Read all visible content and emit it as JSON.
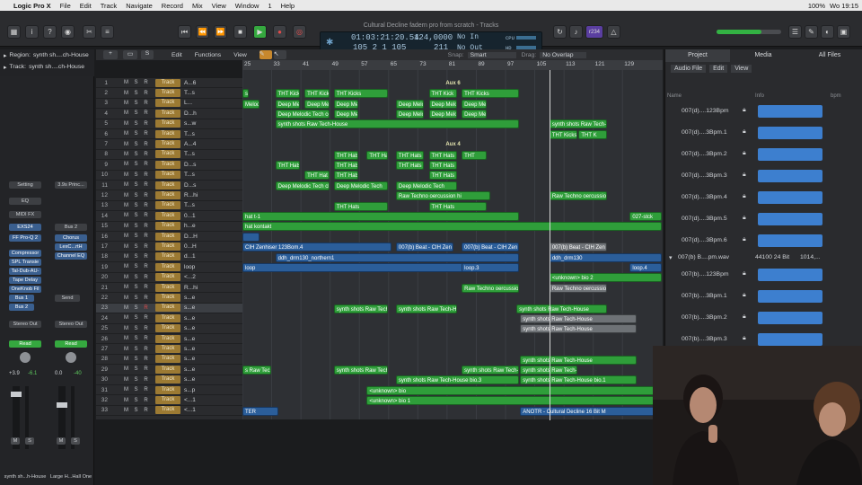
{
  "menubar": {
    "apple": "",
    "app": "Logic Pro X",
    "items": [
      "File",
      "Edit",
      "Track",
      "Navigate",
      "Record",
      "Mix",
      "View",
      "Window",
      "1",
      "Help"
    ],
    "status": [
      "100%",
      "Wo 19:15"
    ]
  },
  "window_title": "Cultural Decline fadern pro from scratch - Tracks",
  "lcd": {
    "position_time": "01:03:21:20.54",
    "position_bars": "105  2  1  105",
    "tempo": "124,0000",
    "tempo_sub": "211",
    "midi_in": "No In",
    "midi_out": "No Out",
    "cpu_label": "CPU",
    "hd_label": "HD"
  },
  "toolbar_badge": "r234",
  "inspector": {
    "region_label": "Region:",
    "region_value": "synth sh....ch-House",
    "track_label": "Track:",
    "track_value": "synth sh....ch-House",
    "strip1": {
      "setting": "Setting",
      "eq": "EQ",
      "midi_fx": "MIDI FX",
      "inst": "EXS24",
      "plugins": [
        "FF Pro-Q 2",
        "Compressor",
        "SPL Transie",
        "Tal-Dub-AU-",
        "Tape Delay",
        "OneKnob Fil"
      ],
      "sends": [
        "Bus 1",
        "Bus 2"
      ],
      "output": "Stereo Out",
      "mode": "Read",
      "vol": "+3.9",
      "peak": "-6.1",
      "name": "synth sh...h-House"
    },
    "strip2": {
      "setting": "3.9s Princ...",
      "inst": "Chorus",
      "bus": "Bus 2",
      "plugins": [
        "LexC...rtH",
        "Channel EQ"
      ],
      "send": "Send",
      "output": "Stereo Out",
      "mode": "Read",
      "vol": "0.0",
      "peak": "-40",
      "name": "Large H...Hall One"
    }
  },
  "arrange_toolbar": {
    "edit": "Edit",
    "functions": "Functions",
    "view": "View",
    "snap_label": "Snap:",
    "snap_value": "Smart",
    "drag_label": "Drag:",
    "drag_value": "No Overlap"
  },
  "ruler": [
    "25",
    "33",
    "41",
    "49",
    "57",
    "65",
    "73",
    "81",
    "89",
    "97",
    "105",
    "113",
    "121",
    "129"
  ],
  "tracks": [
    {
      "n": "1",
      "name": "A...6"
    },
    {
      "n": "2",
      "name": "T...s"
    },
    {
      "n": "3",
      "name": "L..."
    },
    {
      "n": "4",
      "name": "D...h"
    },
    {
      "n": "5",
      "name": "s...w"
    },
    {
      "n": "6",
      "name": "T...s"
    },
    {
      "n": "7",
      "name": "A...4"
    },
    {
      "n": "8",
      "name": "T...s"
    },
    {
      "n": "9",
      "name": "D...s"
    },
    {
      "n": "10",
      "name": "T...s"
    },
    {
      "n": "11",
      "name": "D...s"
    },
    {
      "n": "12",
      "name": "R...hi"
    },
    {
      "n": "13",
      "name": "T...s"
    },
    {
      "n": "14",
      "name": "0...1"
    },
    {
      "n": "15",
      "name": "h...e"
    },
    {
      "n": "16",
      "name": "D...H"
    },
    {
      "n": "17",
      "name": "0...H"
    },
    {
      "n": "18",
      "name": "d...1"
    },
    {
      "n": "19",
      "name": "loop"
    },
    {
      "n": "20",
      "name": "<...2"
    },
    {
      "n": "21",
      "name": "R...hi"
    },
    {
      "n": "22",
      "name": "s...e"
    },
    {
      "n": "23",
      "name": "s...e"
    },
    {
      "n": "24",
      "name": "s...e"
    },
    {
      "n": "25",
      "name": "s...e"
    },
    {
      "n": "26",
      "name": "s...e"
    },
    {
      "n": "27",
      "name": "s...e"
    },
    {
      "n": "28",
      "name": "s...e"
    },
    {
      "n": "29",
      "name": "s...e"
    },
    {
      "n": "30",
      "name": "s...e"
    },
    {
      "n": "31",
      "name": "s...p"
    },
    {
      "n": "32",
      "name": "<...1"
    },
    {
      "n": "33",
      "name": "<...1"
    }
  ],
  "track_type_label": "Track",
  "msr": [
    "M",
    "S",
    "R",
    "I"
  ],
  "regions": [
    {
      "track": 1,
      "text": "Aux 6",
      "start": 25,
      "end": 140,
      "color": "folder"
    },
    {
      "track": 2,
      "text": "s",
      "start": 25,
      "end": 27,
      "color": "green"
    },
    {
      "track": 2,
      "text": "THT Kick",
      "start": 34,
      "end": 41,
      "color": "green"
    },
    {
      "track": 2,
      "text": "THT Kick",
      "start": 42,
      "end": 49,
      "color": "green"
    },
    {
      "track": 2,
      "text": "THT Kicks",
      "start": 50,
      "end": 65,
      "color": "green"
    },
    {
      "track": 2,
      "text": "THT Kick",
      "start": 76,
      "end": 84,
      "color": "green"
    },
    {
      "track": 2,
      "text": "THT Kicks",
      "start": 85,
      "end": 101,
      "color": "green"
    },
    {
      "track": 3,
      "text": "Melodi",
      "start": 25,
      "end": 30,
      "color": "green"
    },
    {
      "track": 3,
      "text": "Deep Melodic Tec",
      "start": 34,
      "end": 41,
      "color": "green"
    },
    {
      "track": 3,
      "text": "Deep Melodic",
      "start": 42,
      "end": 49,
      "color": "green"
    },
    {
      "track": 3,
      "text": "Deep Melodic",
      "start": 50,
      "end": 57,
      "color": "green"
    },
    {
      "track": 3,
      "text": "Deep Melodic Tec",
      "start": 67,
      "end": 75,
      "color": "green"
    },
    {
      "track": 3,
      "text": "Deep Melodic",
      "start": 76,
      "end": 84,
      "color": "green"
    },
    {
      "track": 3,
      "text": "Deep Melodic",
      "start": 85,
      "end": 92,
      "color": "green"
    },
    {
      "track": 4,
      "text": "Deep Melodic Tech ceo",
      "start": 34,
      "end": 49,
      "color": "green"
    },
    {
      "track": 4,
      "text": "Deep Melodic",
      "start": 50,
      "end": 57,
      "color": "green"
    },
    {
      "track": 4,
      "text": "Deep Melodic Tec",
      "start": 67,
      "end": 75,
      "color": "green"
    },
    {
      "track": 4,
      "text": "Deep Melodic",
      "start": 76,
      "end": 84,
      "color": "green"
    },
    {
      "track": 4,
      "text": "Deep Melodic",
      "start": 85,
      "end": 92,
      "color": "green"
    },
    {
      "track": 5,
      "text": "synth shots Raw Tech-House",
      "start": 34,
      "end": 101,
      "color": "green"
    },
    {
      "track": 5,
      "text": "synth shots Raw Tech-H",
      "start": 109,
      "end": 125,
      "color": "green"
    },
    {
      "track": 6,
      "text": "THT Kicks",
      "start": 109,
      "end": 117,
      "color": "green"
    },
    {
      "track": 6,
      "text": "THT K",
      "start": 117,
      "end": 125,
      "color": "green"
    },
    {
      "track": 7,
      "text": "Aux 4",
      "start": 25,
      "end": 140,
      "color": "folder"
    },
    {
      "track": 8,
      "text": "THT Hats",
      "start": 50,
      "end": 57,
      "color": "green"
    },
    {
      "track": 8,
      "text": "THT Hats",
      "start": 59,
      "end": 65,
      "color": "green"
    },
    {
      "track": 8,
      "text": "THT Hats",
      "start": 67,
      "end": 75,
      "color": "green"
    },
    {
      "track": 8,
      "text": "THT Hats",
      "start": 76,
      "end": 84,
      "color": "green"
    },
    {
      "track": 8,
      "text": "THT",
      "start": 85,
      "end": 92,
      "color": "green"
    },
    {
      "track": 9,
      "text": "THT Hats",
      "start": 34,
      "end": 41,
      "color": "green"
    },
    {
      "track": 9,
      "text": "THT Hats",
      "start": 50,
      "end": 57,
      "color": "green"
    },
    {
      "track": 9,
      "text": "THT Hats",
      "start": 67,
      "end": 75,
      "color": "green"
    },
    {
      "track": 9,
      "text": "THT Hats",
      "start": 76,
      "end": 84,
      "color": "green"
    },
    {
      "track": 10,
      "text": "THT Hat",
      "start": 42,
      "end": 49,
      "color": "green"
    },
    {
      "track": 10,
      "text": "THT Hats",
      "start": 50,
      "end": 57,
      "color": "green"
    },
    {
      "track": 10,
      "text": "THT Hats",
      "start": 76,
      "end": 84,
      "color": "green"
    },
    {
      "track": 11,
      "text": "Deep Melodic Tech cla",
      "start": 34,
      "end": 49,
      "color": "green"
    },
    {
      "track": 11,
      "text": "Deep Melodic Tech",
      "start": 50,
      "end": 65,
      "color": "green"
    },
    {
      "track": 11,
      "text": "Deep Melodic Tech",
      "start": 67,
      "end": 84,
      "color": "green"
    },
    {
      "track": 12,
      "text": "Raw Techno oercussion hi",
      "start": 67,
      "end": 93,
      "color": "green"
    },
    {
      "track": 12,
      "text": "Raw Techno oercussion",
      "start": 109,
      "end": 125,
      "color": "green"
    },
    {
      "track": 13,
      "text": "THT Hats",
      "start": 50,
      "end": 65,
      "color": "green"
    },
    {
      "track": 13,
      "text": "THT Hats",
      "start": 76,
      "end": 92,
      "color": "green"
    },
    {
      "track": 14,
      "text": "hat t-1",
      "start": 25,
      "end": 101,
      "color": "green"
    },
    {
      "track": 14,
      "text": "027-stck",
      "start": 131,
      "end": 140,
      "color": "green"
    },
    {
      "track": 15,
      "text": "hat kontakt",
      "start": 25,
      "end": 140,
      "color": "green"
    },
    {
      "track": 16,
      "text": "",
      "start": 25,
      "end": 30,
      "color": "blue"
    },
    {
      "track": 17,
      "text": "CIH Zenhiser 123Bom.4",
      "start": 25,
      "end": 66,
      "color": "blue"
    },
    {
      "track": 17,
      "text": "007(b) Beat - CIH Zen",
      "start": 67,
      "end": 83,
      "color": "blue"
    },
    {
      "track": 17,
      "text": "007(b) Beat - CIH Zen",
      "start": 85,
      "end": 101,
      "color": "blue"
    },
    {
      "track": 17,
      "text": "007(b) Beat - CIH Zen",
      "start": 109,
      "end": 125,
      "color": "grey"
    },
    {
      "track": 18,
      "text": "ddh_drm130_northern1",
      "start": 34,
      "end": 101,
      "color": "blue"
    },
    {
      "track": 18,
      "text": "ddh_drm130",
      "start": 109,
      "end": 140,
      "color": "blue"
    },
    {
      "track": 19,
      "text": "loop",
      "start": 25,
      "end": 101,
      "color": "blue"
    },
    {
      "track": 19,
      "text": "loop.3",
      "start": 85,
      "end": 101,
      "color": "blue"
    },
    {
      "track": 19,
      "text": "loop.4",
      "start": 131,
      "end": 140,
      "color": "blue"
    },
    {
      "track": 20,
      "text": "<unknown> bio 2",
      "start": 109,
      "end": 140,
      "color": "green"
    },
    {
      "track": 21,
      "text": "Raw Techno oercussion",
      "start": 85,
      "end": 101,
      "color": "green"
    },
    {
      "track": 21,
      "text": "Raw Techno oercussion",
      "start": 109,
      "end": 125,
      "color": "grey"
    },
    {
      "track": 23,
      "text": "synth shots Raw Tech-H",
      "start": 50,
      "end": 65,
      "color": "green"
    },
    {
      "track": 23,
      "text": "synth shots Raw Tech-House",
      "start": 67,
      "end": 84,
      "color": "green"
    },
    {
      "track": 23,
      "text": "synth shots Raw Tech-House",
      "start": 100,
      "end": 125,
      "color": "green"
    },
    {
      "track": 24,
      "text": "synth shots Raw Tech-House",
      "start": 101,
      "end": 133,
      "color": "grey"
    },
    {
      "track": 25,
      "text": "synth shots Raw Tech-House",
      "start": 101,
      "end": 133,
      "color": "grey"
    },
    {
      "track": 28,
      "text": "synth shots Raw Tech-House",
      "start": 101,
      "end": 133,
      "color": "green"
    },
    {
      "track": 29,
      "text": "s Raw Tech-H",
      "start": 25,
      "end": 33,
      "color": "green"
    },
    {
      "track": 29,
      "text": "synth shots Raw Tech-H",
      "start": 50,
      "end": 65,
      "color": "green"
    },
    {
      "track": 29,
      "text": "synth shots Raw Tech-H",
      "start": 85,
      "end": 101,
      "color": "green"
    },
    {
      "track": 29,
      "text": "synth shots Raw Tech-H",
      "start": 101,
      "end": 117,
      "color": "green"
    },
    {
      "track": 30,
      "text": "synth shots Raw Tech-House bio.3",
      "start": 67,
      "end": 101,
      "color": "green"
    },
    {
      "track": 30,
      "text": "synth shots Raw Tech-House bio.1",
      "start": 101,
      "end": 133,
      "color": "green"
    },
    {
      "track": 31,
      "text": "<unknown> bio",
      "start": 59,
      "end": 140,
      "color": "green"
    },
    {
      "track": 32,
      "text": "<unknown> bio 1",
      "start": 59,
      "end": 140,
      "color": "green"
    },
    {
      "track": 33,
      "text": "TER",
      "start": 25,
      "end": 35,
      "color": "blue"
    },
    {
      "track": 33,
      "text": "ANOTR - Cultural Decline 16 Bit M",
      "start": 101,
      "end": 140,
      "color": "blue"
    }
  ],
  "browser": {
    "tabs": [
      "Project",
      "Media",
      "All Files"
    ],
    "toolbar": [
      "Audio File",
      "Edit",
      "View"
    ],
    "cols": [
      "Name",
      "Info",
      "bpm"
    ],
    "files": [
      "007(d)....123Bpm",
      "007(d)....3Bpm.1",
      "007(d)....3Bpm.2",
      "007(d)....3Bpm.3",
      "007(d)....3Bpm.4",
      "007(d)....3Bpm.5",
      "007(d)....3Bpm.6"
    ],
    "group": {
      "name": "007(b) B....pm.wav",
      "info": "44100  24 Bit",
      "size": "1014,..."
    },
    "files2": [
      "007(b)....123Bpm",
      "007(b)....3Bpm.1",
      "007(b)....3Bpm.2",
      "007(b)....3Bpm.3"
    ]
  },
  "colors": {
    "green_region": "#2f9e3a",
    "blue_region": "#2b5e9a",
    "track_color": "#9c7a33",
    "play": "#35a83f"
  }
}
